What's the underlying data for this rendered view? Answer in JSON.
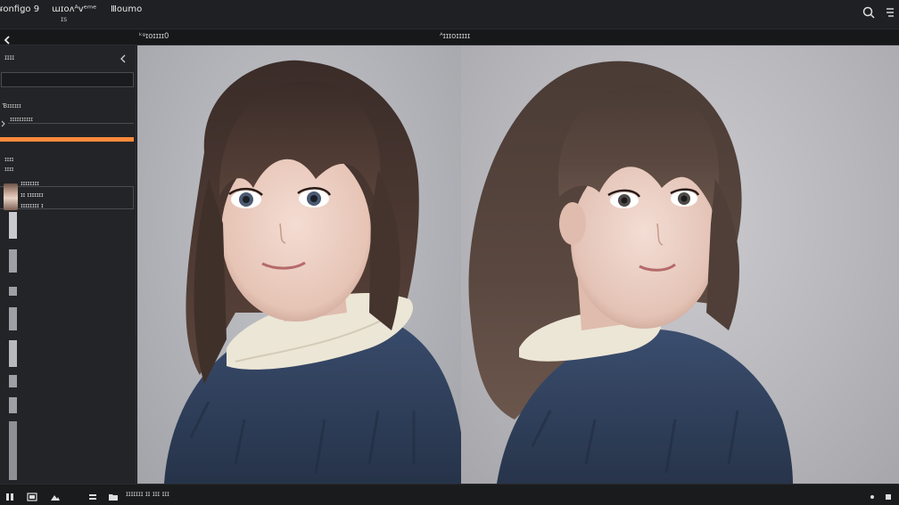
{
  "topbar": {
    "menu1": "ᵲonfiǥo 9",
    "menu2": "ɯɪoʌᴬᴠᵉᵐᵉ",
    "menu3": "Ⅲoumo",
    "submenu": "ɪs",
    "search_icon": "search-icon",
    "menu_icon": "hamburger-icon"
  },
  "subbar": {
    "back_icon": "back-arrow-icon",
    "left_label": "ᵏᵍɪoɪɪɪɪ0",
    "center_label": "ᴬɪɪɪoɪɪɪɪɪ"
  },
  "sidebar": {
    "title": "ɪɪɪɪ",
    "collapse_icon": "chevron-left-icon",
    "input_value": "",
    "section1": "Ɓɪɪɪɪɪɪ",
    "section1_item": "ɪɪɪɪɪɪɪɪɪɪ",
    "progress": 1.0,
    "section2": "ɪɪɪɪ",
    "section2_sub": "ɪɪɪɪ",
    "row_title": "ɪɪɪɪɪɪɪɪ",
    "row_line1": "ɪɪ ɪɪɪɪɪɪɪ",
    "row_line2": "ɪɪɪɪɪɪɪɪ ɪ"
  },
  "bottombar": {
    "status": "ɪɪɪɪɪɪɪ ɪɪ ɪɪɪ ɪɪɪ"
  },
  "colors": {
    "accent": "#ff8a3c",
    "background": "#1c1d20",
    "sidebar": "#232427"
  }
}
